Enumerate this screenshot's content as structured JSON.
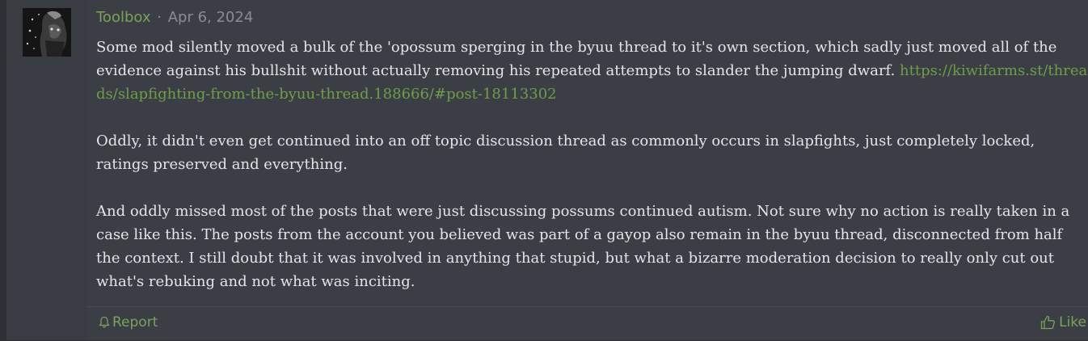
{
  "post": {
    "username": "Toolbox",
    "separator": "·",
    "date": "Apr 6, 2024",
    "paragraphs": [
      {
        "text": "Some mod silently moved a bulk of the 'opossum sperging in the byuu thread to it's own section, which sadly just moved all of the evidence against his bullshit without actually removing his repeated attempts to slander the jumping dwarf. ",
        "link": "https://kiwifarms.st/threads/slapfighting-from-the-byuu-thread.188666/#post-18113302"
      },
      {
        "text": "Oddly, it didn't even get continued into an off topic discussion thread as commonly occurs in slapfights, just completely locked, ratings preserved and everything."
      },
      {
        "text": "And oddly missed most of the posts that were just discussing possums continued autism. Not sure why no action is really taken in a case like this. The posts from the account you believed was part of a gayop also remain in the byuu thread, disconnected from half the context. I still doubt that it was involved in anything that stupid, but what a bizarre moderation decision to really only cut out what's rebuking and not what was inciting."
      }
    ],
    "actions": {
      "report_label": "Report",
      "like_label": "Like"
    },
    "icons": {
      "report": "bell-icon",
      "like": "thumbs-up-icon"
    },
    "colors": {
      "username": "#79a35a",
      "link": "#6e9d4a",
      "background": "#3c3e45"
    }
  }
}
